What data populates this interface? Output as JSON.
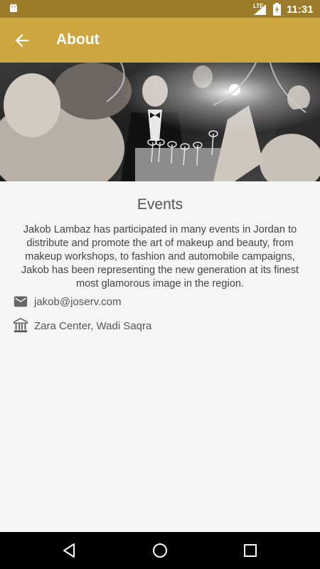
{
  "status_bar": {
    "network_label": "LTE",
    "time": "11:31",
    "icons": [
      "android-icon",
      "signal-icon",
      "battery-icon"
    ]
  },
  "app_bar": {
    "title": "About",
    "back_icon": "arrow-back-icon",
    "background_color": "#cca63e"
  },
  "hero": {
    "image": "event-photo"
  },
  "content": {
    "section_title": "Events",
    "description": "Jakob Lambaz has participated in many events in Jordan to distribute and promote the art of makeup and beauty, from makeup workshops, to fashion and automobile campaigns, Jakob has been representing the new generation at its finest most glamorous image in the region.",
    "email": {
      "icon": "email-icon",
      "value": "jakob@joserv.com"
    },
    "address": {
      "icon": "bank-building-icon",
      "value": "Zara Center, Wadi Saqra"
    }
  },
  "nav_bar": {
    "buttons": [
      "nav-back-icon",
      "nav-home-icon",
      "nav-recents-icon"
    ]
  }
}
